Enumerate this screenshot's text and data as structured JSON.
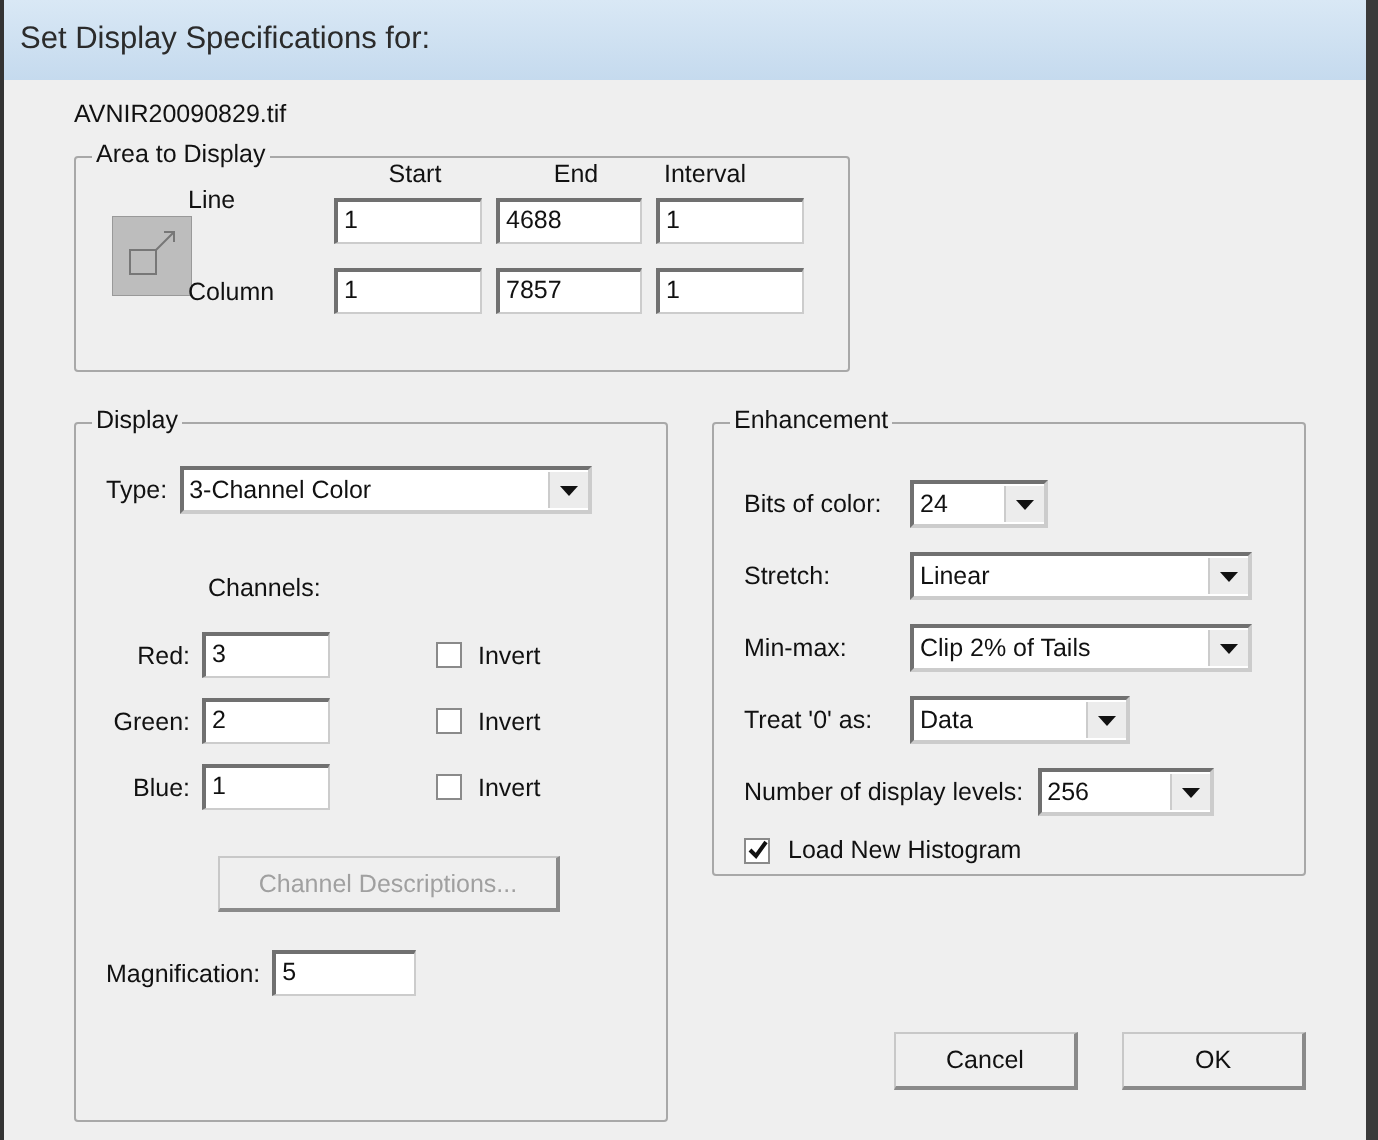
{
  "window": {
    "title": "Set Display Specifications for:"
  },
  "filename": "AVNIR20090829.tif",
  "area": {
    "title": "Area to Display",
    "columns": [
      "Start",
      "End",
      "Interval"
    ],
    "rows": [
      {
        "label": "Line",
        "values": [
          "1",
          "4688",
          "1"
        ]
      },
      {
        "label": "Column",
        "values": [
          "1",
          "7857",
          "1"
        ]
      }
    ]
  },
  "display": {
    "title": "Display",
    "type_label": "Type:",
    "type_value": "3-Channel Color",
    "channels_label": "Channels:",
    "channels": [
      {
        "label": "Red:",
        "value": "3",
        "invert_label": "Invert",
        "checked": false
      },
      {
        "label": "Green:",
        "value": "2",
        "invert_label": "Invert",
        "checked": false
      },
      {
        "label": "Blue:",
        "value": "1",
        "invert_label": "Invert",
        "checked": false
      }
    ],
    "descriptions_button": {
      "label": "Channel Descriptions...",
      "disabled": true
    },
    "magnification_label": "Magnification:",
    "magnification_value": "5"
  },
  "enhancement": {
    "title": "Enhancement",
    "selects": [
      {
        "label": "Bits of color:",
        "value": "24"
      },
      {
        "label": "Stretch:",
        "value": "Linear"
      },
      {
        "label": "Min-max:",
        "value": "Clip 2% of Tails"
      },
      {
        "label": "Treat '0' as:",
        "value": "Data"
      },
      {
        "label": "Number of display levels:",
        "value": "256"
      }
    ],
    "histogram": {
      "label": "Load New Histogram",
      "checked": true
    }
  },
  "buttons": [
    "Cancel",
    "OK"
  ]
}
